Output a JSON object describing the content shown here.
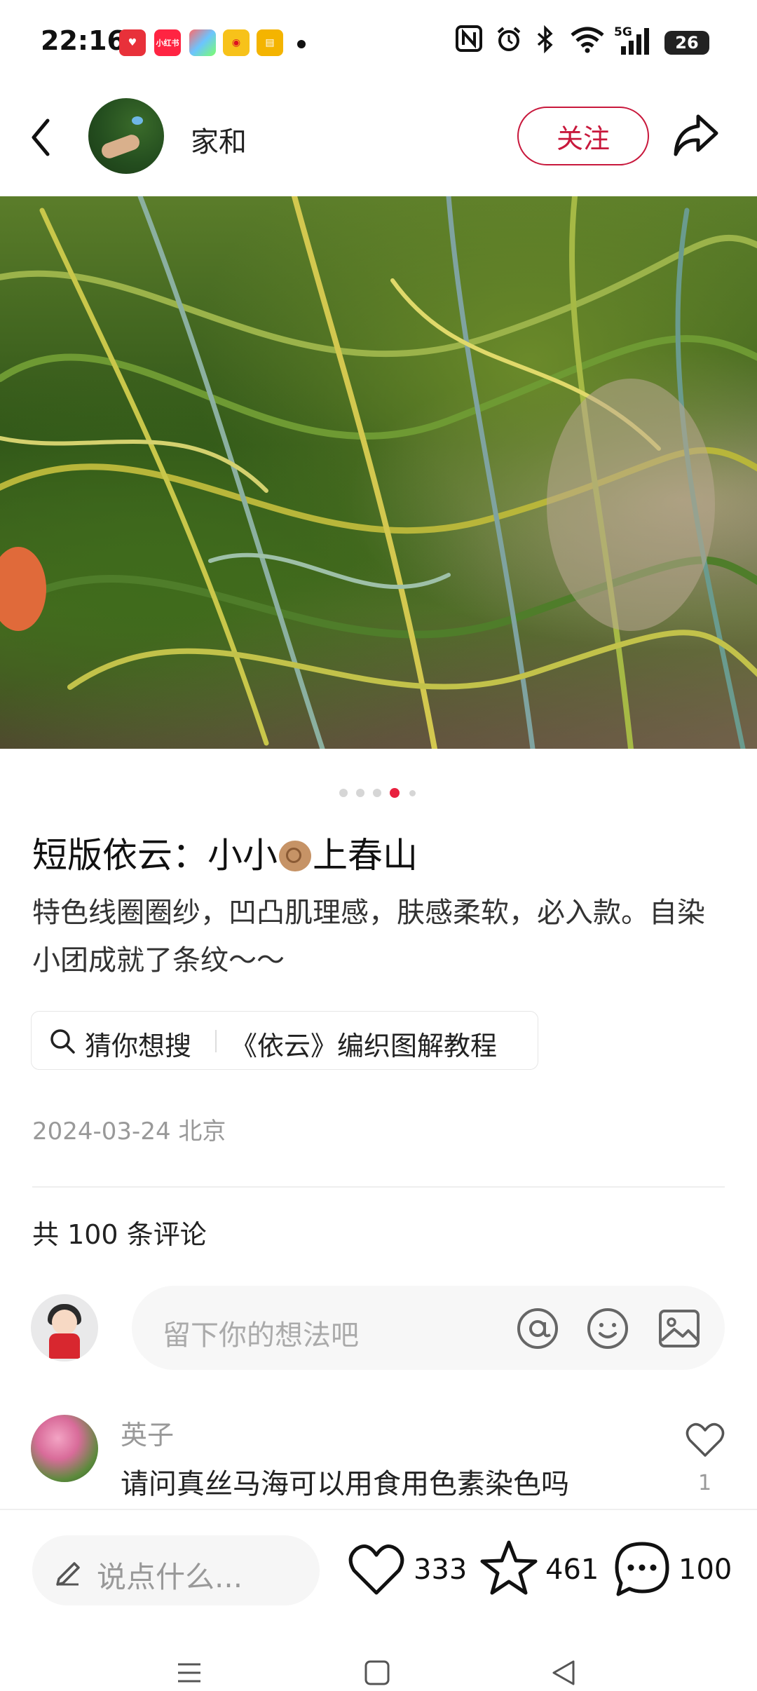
{
  "status_bar": {
    "time": "22:16",
    "network": "5G",
    "battery": "26",
    "app_icons": [
      "heart-app-icon",
      "xiaohongshu-app-icon",
      "colorful-app-icon",
      "weibo-app-icon",
      "notes-app-icon"
    ],
    "xiaohongshu_label": "小红书"
  },
  "header": {
    "author_name": "家和",
    "follow_label": "关注"
  },
  "pager": {
    "count": 5,
    "active_index": 3
  },
  "post": {
    "title_prefix": "短版依云：小小",
    "title_suffix": "上春山",
    "description": "特色线圈圈纱，凹凸肌理感，肤感柔软，必入款。自染小团成就了条纹～～",
    "search_guess_label": "猜你想搜",
    "search_suggestion": "《依云》编织图解教程",
    "date_location": "2024-03-24 北京"
  },
  "comments": {
    "count_label": "共 100 条评论",
    "input_placeholder": "留下你的想法吧",
    "items": [
      {
        "user": "英子",
        "text": "请问真丝马海可以用食用色素染色吗",
        "likes": "1"
      }
    ]
  },
  "bottom_bar": {
    "say_placeholder": "说点什么...",
    "likes": "333",
    "favorites": "461",
    "comments": "100"
  },
  "colors": {
    "accent": "#c8183c",
    "pager_active": "#e8213f"
  }
}
